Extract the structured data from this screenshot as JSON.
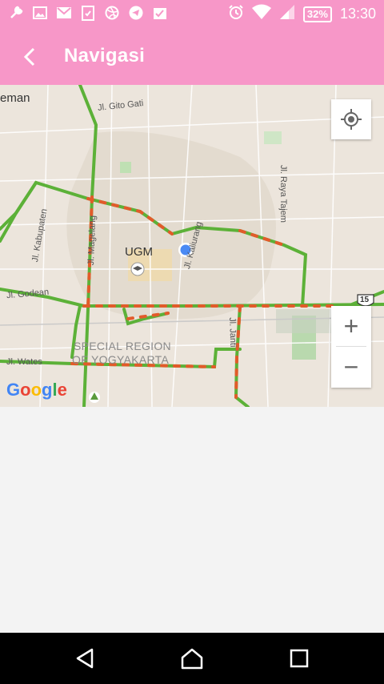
{
  "status_bar": {
    "left_icons": [
      "wrench-icon",
      "image-icon",
      "gmail-icon",
      "clipboard-icon",
      "dribbble-icon",
      "telegram-icon",
      "checklist-icon"
    ],
    "right_icons": [
      "alarm-icon",
      "wifi-icon",
      "signal-icon"
    ],
    "battery": "32%",
    "time": "13:30"
  },
  "app_bar": {
    "title": "Navigasi",
    "color": "#f797c8"
  },
  "map": {
    "labels": {
      "sleman": "eman",
      "gito": "Jl. Gito Gati",
      "raya_tajem": "Jl. Raya Tajem",
      "kabupaten": "Jl. Kabupaten",
      "magelang": "Jl. Magelang",
      "kaliurang": "Jl. Kaliurang",
      "ugm": "UGM",
      "godean": "Jl. Godean",
      "wates": "Jl. Wates",
      "janti": "Jl. Janti",
      "route": "15",
      "region_line1": "SPECIAL REGION",
      "region_line2": "OF YOGYAKARTA"
    },
    "zoom_in": "+",
    "zoom_out": "−",
    "google": [
      "G",
      "o",
      "o",
      "g",
      "l",
      "e"
    ],
    "google_colors": [
      "#4285f4",
      "#ea4335",
      "#fbbc05",
      "#4285f4",
      "#34a853",
      "#ea4335"
    ]
  },
  "nav_bar": {
    "buttons": [
      "back-icon",
      "home-icon",
      "recents-icon"
    ]
  }
}
